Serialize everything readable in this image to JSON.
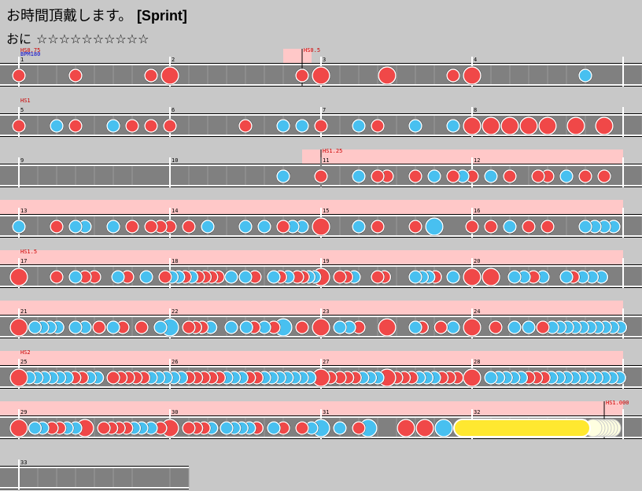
{
  "header": {
    "song_title": "お時間頂戴します。",
    "subtitle_tag": "[Sprint]",
    "difficulty_label": "おに",
    "stars": "☆☆☆☆☆☆☆☆☆☆"
  },
  "colors": {
    "background": "#c8c8c8",
    "lane": "#808080",
    "speed_highlight": "#ffc8c8",
    "don": "#f04848",
    "ka": "#48c0f0",
    "roll": "#ffe830",
    "marker_red": "#cc0000",
    "marker_blue": "#0000cc"
  },
  "rows": [
    {
      "measures": [
        "1",
        "2",
        "3",
        "4"
      ],
      "annotations": [
        {
          "text": "HS0.75",
          "color": "red",
          "beat": 0
        },
        {
          "text": "BPM180",
          "color": "blue",
          "beat": 0
        },
        {
          "text": "HS0.5",
          "color": "red",
          "beat": 15
        }
      ],
      "highlight": [
        [
          15,
          16.5
        ]
      ],
      "notes": [
        [
          0.25,
          "d"
        ],
        [
          3.25,
          "d"
        ],
        [
          7.25,
          "d"
        ],
        [
          8.25,
          "D"
        ],
        [
          15.25,
          "d"
        ],
        [
          16.25,
          "D"
        ],
        [
          19.75,
          "D"
        ],
        [
          23.25,
          "d"
        ],
        [
          24.25,
          "D"
        ],
        [
          30.25,
          "k"
        ]
      ]
    },
    {
      "measures": [
        "5",
        "6",
        "7",
        "8"
      ],
      "annotations": [
        {
          "text": "HS1",
          "color": "red",
          "beat": 0
        }
      ],
      "highlight": [],
      "notes": [
        [
          0.25,
          "d"
        ],
        [
          2.25,
          "k"
        ],
        [
          3.25,
          "d"
        ],
        [
          5.25,
          "k"
        ],
        [
          6.25,
          "d"
        ],
        [
          7.25,
          "d"
        ],
        [
          8.25,
          "d"
        ],
        [
          12.25,
          "d"
        ],
        [
          14.25,
          "k"
        ],
        [
          15.25,
          "k"
        ],
        [
          16.25,
          "d"
        ],
        [
          18.25,
          "k"
        ],
        [
          19.25,
          "d"
        ],
        [
          21.25,
          "k"
        ],
        [
          23.25,
          "k"
        ],
        [
          24.25,
          "D"
        ],
        [
          25.25,
          "D"
        ],
        [
          26.25,
          "D"
        ],
        [
          27.25,
          "D"
        ],
        [
          28.25,
          "D"
        ],
        [
          29.75,
          "D"
        ],
        [
          31.25,
          "D"
        ]
      ]
    },
    {
      "measures": [
        "9",
        "10",
        "11",
        "12"
      ],
      "annotations": [
        {
          "text": "HS1.25",
          "color": "red",
          "beat": 16
        }
      ],
      "highlight": [
        [
          16,
          33
        ]
      ],
      "notes": [
        [
          14.25,
          "k"
        ],
        [
          16.25,
          "d"
        ],
        [
          18.25,
          "k"
        ],
        [
          19.25,
          "d"
        ],
        [
          19.75,
          "d"
        ],
        [
          21.25,
          "d"
        ],
        [
          22.25,
          "k"
        ],
        [
          23.25,
          "d"
        ],
        [
          23.75,
          "k"
        ],
        [
          24.25,
          "d"
        ],
        [
          25.25,
          "k"
        ],
        [
          26.25,
          "d"
        ],
        [
          27.75,
          "d"
        ],
        [
          28.25,
          "d"
        ],
        [
          29.25,
          "k"
        ],
        [
          30.25,
          "d"
        ],
        [
          31.25,
          "d"
        ]
      ]
    },
    {
      "measures": [
        "13",
        "14",
        "15",
        "16"
      ],
      "annotations": [],
      "highlight": [
        [
          0,
          33
        ]
      ],
      "notes": [
        [
          0.25,
          "k"
        ],
        [
          2.25,
          "d"
        ],
        [
          3.25,
          "k"
        ],
        [
          3.75,
          "k"
        ],
        [
          5.25,
          "k"
        ],
        [
          6.25,
          "d"
        ],
        [
          7.25,
          "d"
        ],
        [
          7.75,
          "d"
        ],
        [
          8.25,
          "d"
        ],
        [
          9.25,
          "d"
        ],
        [
          10.25,
          "k"
        ],
        [
          12.25,
          "k"
        ],
        [
          13.25,
          "k"
        ],
        [
          14.25,
          "d"
        ],
        [
          14.75,
          "k"
        ],
        [
          15.25,
          "k"
        ],
        [
          16.25,
          "D"
        ],
        [
          18.25,
          "k"
        ],
        [
          19.25,
          "d"
        ],
        [
          21.25,
          "d"
        ],
        [
          22.25,
          "K"
        ],
        [
          24.25,
          "d"
        ],
        [
          25.25,
          "d"
        ],
        [
          26.25,
          "k"
        ],
        [
          27.25,
          "d"
        ],
        [
          28.25,
          "d"
        ],
        [
          30.25,
          "k"
        ],
        [
          30.75,
          "k"
        ],
        [
          31.25,
          "k"
        ],
        [
          31.75,
          "k"
        ]
      ]
    },
    {
      "measures": [
        "17",
        "18",
        "19",
        "20"
      ],
      "annotations": [
        {
          "text": "HS1.5",
          "color": "red",
          "beat": 0
        }
      ],
      "highlight": [
        [
          0,
          33
        ]
      ],
      "notes": [
        [
          0.25,
          "D"
        ],
        [
          2.25,
          "d"
        ],
        [
          3.25,
          "k"
        ],
        [
          3.75,
          "d"
        ],
        [
          4.25,
          "d"
        ],
        [
          5.5,
          "k"
        ],
        [
          6,
          "d"
        ],
        [
          7,
          "k"
        ],
        [
          8,
          "d"
        ],
        [
          8.35,
          "k"
        ],
        [
          8.7,
          "k"
        ],
        [
          9.05,
          "d"
        ],
        [
          9.4,
          "k"
        ],
        [
          9.75,
          "d"
        ],
        [
          10.1,
          "d"
        ],
        [
          10.45,
          "d"
        ],
        [
          10.8,
          "d"
        ],
        [
          11.5,
          "k"
        ],
        [
          12.25,
          "k"
        ],
        [
          12.75,
          "d"
        ],
        [
          13.75,
          "k"
        ],
        [
          14.1,
          "d"
        ],
        [
          14.5,
          "k"
        ],
        [
          15,
          "d"
        ],
        [
          15.3,
          "d"
        ],
        [
          15.6,
          "k"
        ],
        [
          15.9,
          "k"
        ],
        [
          16.25,
          "D"
        ],
        [
          17.25,
          "d"
        ],
        [
          17.6,
          "d"
        ],
        [
          18,
          "k"
        ],
        [
          19.25,
          "d"
        ],
        [
          19.6,
          "d"
        ],
        [
          21.25,
          "k"
        ],
        [
          21.6,
          "k"
        ],
        [
          21.95,
          "k"
        ],
        [
          22.3,
          "d"
        ],
        [
          23.25,
          "k"
        ],
        [
          24.25,
          "D"
        ],
        [
          25.25,
          "D"
        ],
        [
          26.5,
          "k"
        ],
        [
          27,
          "k"
        ],
        [
          27.5,
          "d"
        ],
        [
          28,
          "k"
        ],
        [
          29.25,
          "k"
        ],
        [
          29.6,
          "d"
        ],
        [
          30.1,
          "k"
        ],
        [
          30.6,
          "k"
        ],
        [
          31.1,
          "k"
        ]
      ]
    },
    {
      "measures": [
        "21",
        "22",
        "23",
        "24"
      ],
      "annotations": [],
      "highlight": [
        [
          0,
          33
        ]
      ],
      "notes": [
        [
          0.25,
          "D"
        ],
        [
          1.1,
          "k"
        ],
        [
          1.5,
          "k"
        ],
        [
          1.9,
          "k"
        ],
        [
          2.3,
          "k"
        ],
        [
          3.25,
          "k"
        ],
        [
          3.75,
          "k"
        ],
        [
          4.5,
          "d"
        ],
        [
          5.25,
          "k"
        ],
        [
          5.75,
          "d"
        ],
        [
          6.75,
          "d"
        ],
        [
          7.75,
          "k"
        ],
        [
          8.25,
          "K"
        ],
        [
          9.25,
          "d"
        ],
        [
          9.6,
          "d"
        ],
        [
          9.95,
          "d"
        ],
        [
          10.4,
          "k"
        ],
        [
          11.5,
          "k"
        ],
        [
          12.3,
          "k"
        ],
        [
          12.7,
          "d"
        ],
        [
          13.25,
          "k"
        ],
        [
          13.75,
          "d"
        ],
        [
          14.25,
          "K"
        ],
        [
          15.25,
          "d"
        ],
        [
          16.25,
          "D"
        ],
        [
          17.25,
          "k"
        ],
        [
          17.75,
          "k"
        ],
        [
          18.25,
          "d"
        ],
        [
          19.75,
          "D"
        ],
        [
          21.25,
          "k"
        ],
        [
          21.6,
          "d"
        ],
        [
          22.6,
          "d"
        ],
        [
          23.25,
          "k"
        ],
        [
          24.25,
          "D"
        ],
        [
          25.5,
          "d"
        ],
        [
          26.5,
          "k"
        ],
        [
          27.25,
          "k"
        ],
        [
          28,
          "d"
        ],
        [
          28.5,
          "k"
        ],
        [
          28.9,
          "k"
        ],
        [
          29.3,
          "k"
        ],
        [
          29.7,
          "k"
        ],
        [
          30.1,
          "k"
        ],
        [
          30.5,
          "k"
        ],
        [
          30.9,
          "k"
        ],
        [
          31.3,
          "k"
        ],
        [
          31.7,
          "k"
        ],
        [
          32.1,
          "k"
        ]
      ]
    },
    {
      "measures": [
        "25",
        "26",
        "27",
        "28"
      ],
      "annotations": [
        {
          "text": "HS2",
          "color": "red",
          "beat": 0
        }
      ],
      "highlight": [
        [
          0,
          33
        ]
      ],
      "notes": [
        [
          0.25,
          "D"
        ],
        [
          0.8,
          "k"
        ],
        [
          1.2,
          "k"
        ],
        [
          1.6,
          "k"
        ],
        [
          2,
          "k"
        ],
        [
          2.4,
          "k"
        ],
        [
          2.8,
          "k"
        ],
        [
          3.2,
          "d"
        ],
        [
          3.6,
          "d"
        ],
        [
          4,
          "k"
        ],
        [
          4.4,
          "k"
        ],
        [
          5.25,
          "d"
        ],
        [
          5.65,
          "d"
        ],
        [
          6.05,
          "d"
        ],
        [
          6.45,
          "d"
        ],
        [
          6.85,
          "d"
        ],
        [
          7.25,
          "k"
        ],
        [
          7.65,
          "k"
        ],
        [
          8.05,
          "k"
        ],
        [
          8.45,
          "k"
        ],
        [
          8.85,
          "k"
        ],
        [
          9.25,
          "d"
        ],
        [
          9.65,
          "d"
        ],
        [
          10.05,
          "d"
        ],
        [
          10.45,
          "d"
        ],
        [
          10.85,
          "d"
        ],
        [
          11.25,
          "k"
        ],
        [
          11.65,
          "k"
        ],
        [
          12.05,
          "k"
        ],
        [
          12.45,
          "d"
        ],
        [
          12.85,
          "d"
        ],
        [
          13.25,
          "k"
        ],
        [
          13.65,
          "k"
        ],
        [
          14.05,
          "k"
        ],
        [
          14.45,
          "k"
        ],
        [
          14.85,
          "k"
        ],
        [
          15.25,
          "k"
        ],
        [
          15.65,
          "k"
        ],
        [
          16.25,
          "D"
        ],
        [
          16.75,
          "d"
        ],
        [
          17.25,
          "d"
        ],
        [
          17.65,
          "d"
        ],
        [
          18.05,
          "d"
        ],
        [
          18.45,
          "k"
        ],
        [
          18.85,
          "k"
        ],
        [
          19.25,
          "k"
        ],
        [
          19.75,
          "D"
        ],
        [
          20.25,
          "d"
        ],
        [
          20.65,
          "d"
        ],
        [
          21.05,
          "d"
        ],
        [
          21.45,
          "k"
        ],
        [
          21.85,
          "k"
        ],
        [
          22.25,
          "k"
        ],
        [
          22.65,
          "d"
        ],
        [
          23.05,
          "d"
        ],
        [
          23.45,
          "d"
        ],
        [
          24.25,
          "D"
        ],
        [
          25.25,
          "k"
        ],
        [
          25.65,
          "k"
        ],
        [
          26.05,
          "k"
        ],
        [
          26.45,
          "k"
        ],
        [
          26.85,
          "k"
        ],
        [
          27.25,
          "d"
        ],
        [
          27.65,
          "d"
        ],
        [
          28.05,
          "d"
        ],
        [
          28.45,
          "k"
        ],
        [
          28.85,
          "k"
        ],
        [
          29.25,
          "k"
        ],
        [
          29.65,
          "k"
        ],
        [
          30.05,
          "k"
        ],
        [
          30.45,
          "k"
        ],
        [
          30.85,
          "k"
        ],
        [
          31.25,
          "k"
        ],
        [
          31.65,
          "k"
        ],
        [
          32.05,
          "k"
        ]
      ]
    },
    {
      "measures": [
        "29",
        "30",
        "31",
        "32"
      ],
      "annotations": [
        {
          "text": "HS1.000",
          "color": "red",
          "beat": 31
        }
      ],
      "highlight": [
        [
          0,
          33
        ]
      ],
      "notes": [
        [
          0.25,
          "D"
        ],
        [
          1.1,
          "k"
        ],
        [
          1.5,
          "k"
        ],
        [
          2,
          "d"
        ],
        [
          2.4,
          "d"
        ],
        [
          2.8,
          "k"
        ],
        [
          3.25,
          "k"
        ],
        [
          3.75,
          "D"
        ],
        [
          4.75,
          "d"
        ],
        [
          5.15,
          "d"
        ],
        [
          5.55,
          "d"
        ],
        [
          5.95,
          "d"
        ],
        [
          6.35,
          "k"
        ],
        [
          6.75,
          "k"
        ],
        [
          7.25,
          "k"
        ],
        [
          7.75,
          "d"
        ],
        [
          8.25,
          "D"
        ],
        [
          9.25,
          "d"
        ],
        [
          9.65,
          "d"
        ],
        [
          10.05,
          "d"
        ],
        [
          10.45,
          "k"
        ],
        [
          11.25,
          "k"
        ],
        [
          11.65,
          "k"
        ],
        [
          12.05,
          "k"
        ],
        [
          12.45,
          "k"
        ],
        [
          12.85,
          "d"
        ],
        [
          13.75,
          "k"
        ],
        [
          14.25,
          "d"
        ],
        [
          15.25,
          "d"
        ],
        [
          15.75,
          "k"
        ],
        [
          16.25,
          "K"
        ],
        [
          17.25,
          "k"
        ],
        [
          18.25,
          "d"
        ],
        [
          18.75,
          "K"
        ],
        [
          20.75,
          "D"
        ],
        [
          21.75,
          "D"
        ],
        [
          22.75,
          "K"
        ],
        [
          23.75,
          "R"
        ]
      ]
    },
    {
      "measures": [
        "33"
      ],
      "annotations": [],
      "highlight": [],
      "notes": []
    }
  ]
}
